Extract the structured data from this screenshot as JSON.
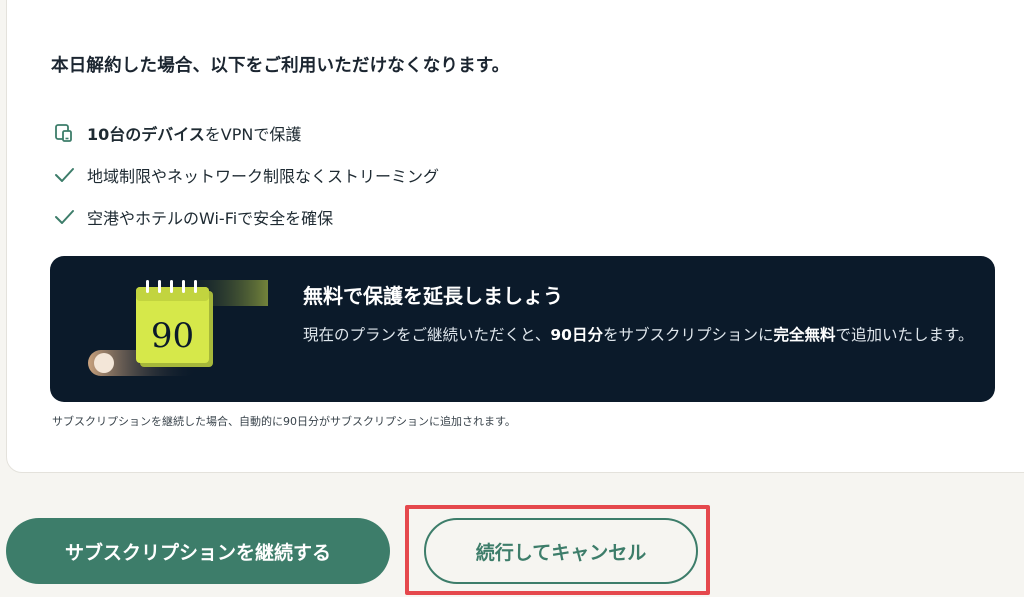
{
  "card": {
    "heading": "本日解約した場合、以下をご利用いただけなくなります。",
    "features": [
      {
        "icon": "devices-icon",
        "bold": "10台のデバイス",
        "text": "をVPNで保護"
      },
      {
        "icon": "check-icon",
        "bold": "",
        "text": "地域制限やネットワーク制限なくストリーミング"
      },
      {
        "icon": "check-icon",
        "bold": "",
        "text": "空港やホテルのWi-Fiで安全を確保"
      }
    ],
    "promo": {
      "calendar_number": "90",
      "title": "無料で保護を延長しましょう",
      "body_part1": "現在のプランをご継続いただくと、",
      "body_bold1": "90日分",
      "body_part2": "をサブスクリプションに",
      "body_bold2": "完全無料",
      "body_part3": "で追加いたします。"
    },
    "footnote": "サブスクリプションを継続した場合、自動的に90日分がサブスクリプションに追加されます。"
  },
  "actions": {
    "continue_label": "サブスクリプションを継続する",
    "cancel_label": "続行してキャンセル"
  },
  "colors": {
    "accent_green": "#3d7d6a",
    "promo_bg": "#0b1a2a",
    "calendar_yellow": "#d6e84a",
    "highlight_red": "#e5484d",
    "page_bg": "#f6f5f1"
  }
}
